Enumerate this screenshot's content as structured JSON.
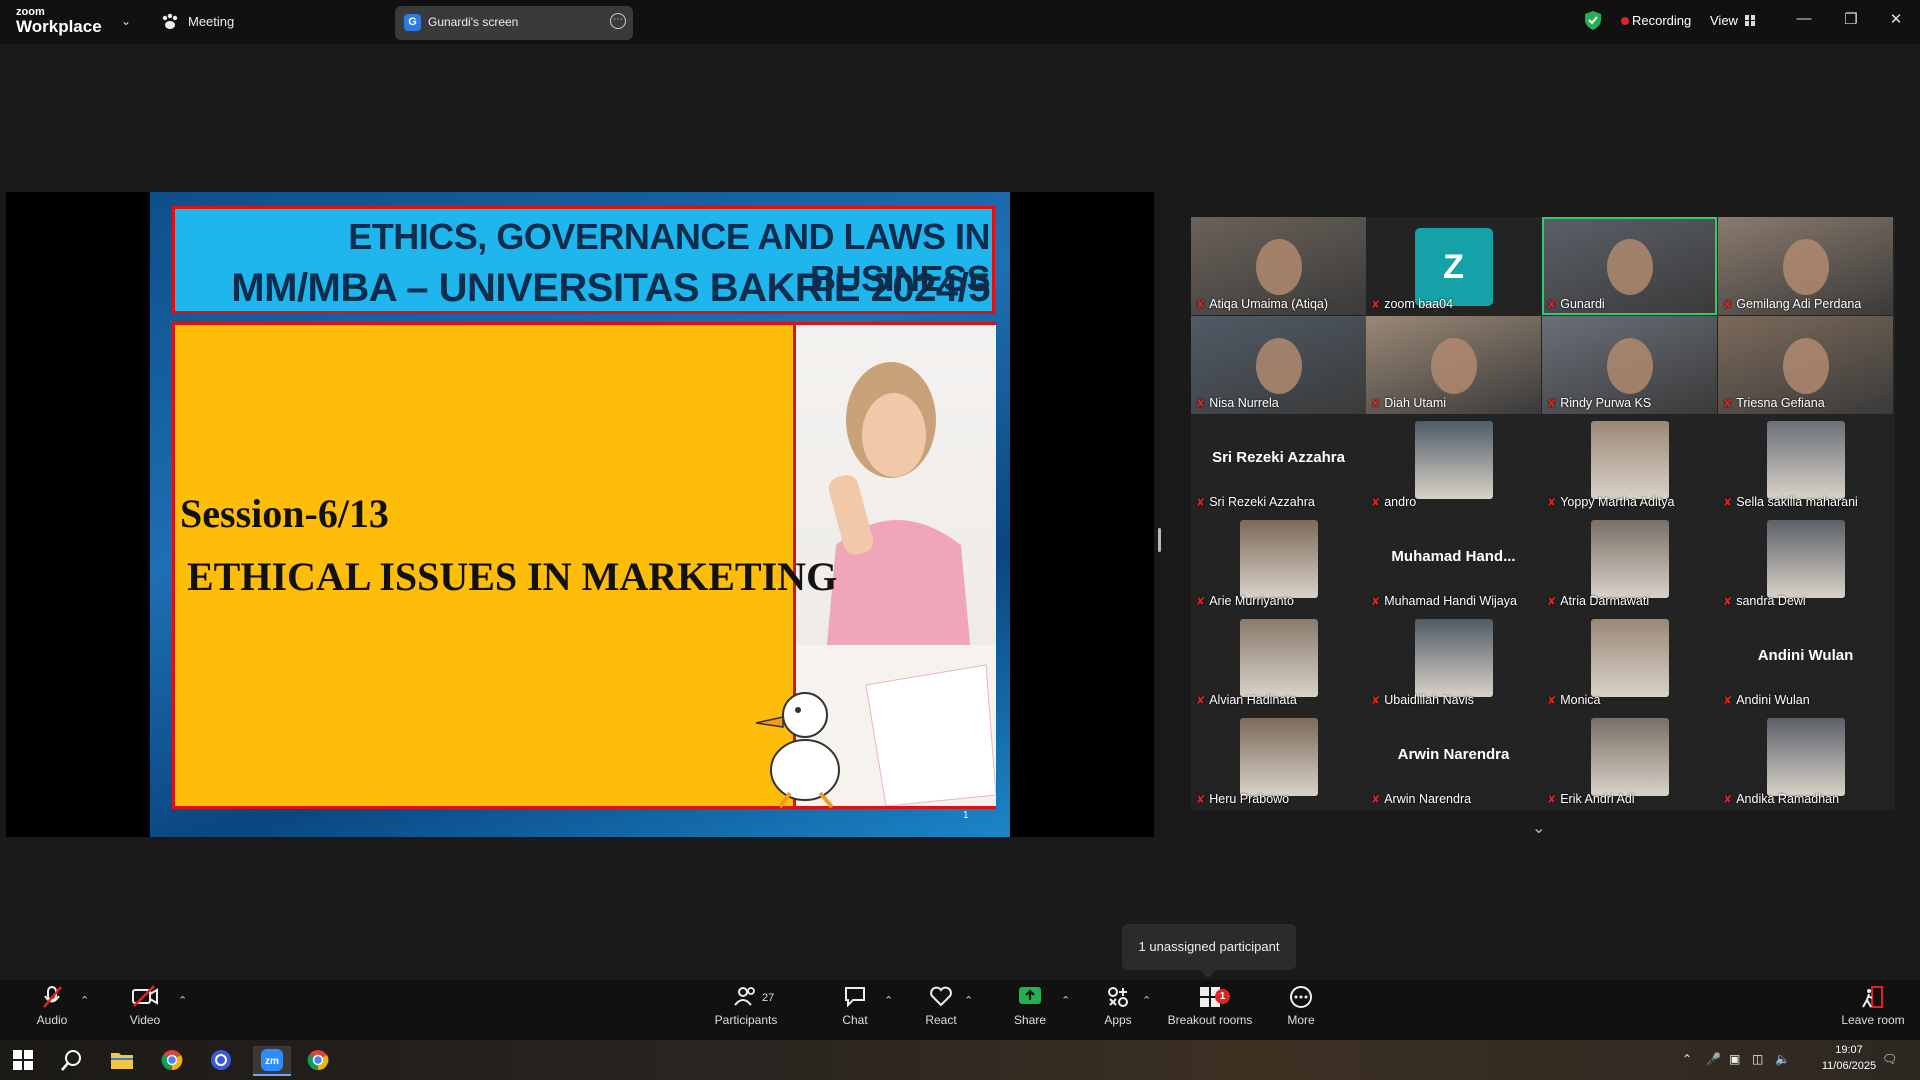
{
  "window": {
    "logo_small": "zoom",
    "logo_big": "Workplace",
    "meeting_label": "Meeting",
    "screen_tab_initial": "G",
    "screen_tab_label": "Gunardi's screen",
    "recording_label": "Recording",
    "view_label": "View",
    "recording_color": "#e02424"
  },
  "slide": {
    "title_line1": "ETHICS, GOVERNANCE AND LAWS IN BUSINESS",
    "title_line2": "MM/MBA – UNIVERSITAS BAKRIE 2024/5",
    "session": "Session-6/13",
    "topic": "ETHICAL ISSUES IN MARKETING",
    "page_number": "1",
    "header_color": "#1fb6ee",
    "body_color": "#fdbd09"
  },
  "gallery": {
    "tiles": [
      {
        "name": "Atiqa Umaima (Atiqa)",
        "kind": "video"
      },
      {
        "name": "zoom baa04",
        "kind": "avatar",
        "avatar_letter": "Z"
      },
      {
        "name": "Gunardi",
        "kind": "video",
        "active": true
      },
      {
        "name": "Gemilang Adi Perdana",
        "kind": "video"
      },
      {
        "name": "Nisa Nurrela",
        "kind": "video"
      },
      {
        "name": "Diah Utami",
        "kind": "video"
      },
      {
        "name": "Rindy Purwa KS",
        "kind": "video"
      },
      {
        "name": "Triesna Gefiana",
        "kind": "video"
      },
      {
        "name": "Sri Rezeki Azzahra",
        "kind": "text",
        "center_text": "Sri Rezeki Azzahra"
      },
      {
        "name": "andro",
        "kind": "photo"
      },
      {
        "name": "Yoppy Martha Aditya",
        "kind": "photo"
      },
      {
        "name": "Sella sakilla maharani",
        "kind": "photo"
      },
      {
        "name": "Arie Murriyanto",
        "kind": "photo"
      },
      {
        "name": "Muhamad Handi Wijaya",
        "kind": "text",
        "center_text": "Muhamad  Hand..."
      },
      {
        "name": "Atria Darmawati",
        "kind": "photo"
      },
      {
        "name": "sandra Dewi",
        "kind": "photo"
      },
      {
        "name": "Alvian Hadinata",
        "kind": "photo"
      },
      {
        "name": "Ubaidillah Navis",
        "kind": "photo"
      },
      {
        "name": "Monica",
        "kind": "photo"
      },
      {
        "name": "Andini Wulan",
        "kind": "text",
        "center_text": "Andini Wulan"
      },
      {
        "name": "Heru Prabowo",
        "kind": "photo"
      },
      {
        "name": "Arwin Narendra",
        "kind": "text",
        "center_text": "Arwin Narendra"
      },
      {
        "name": "Erik Andri Adi",
        "kind": "photo"
      },
      {
        "name": "Andika Ramadhan",
        "kind": "photo"
      }
    ]
  },
  "tooltip": "1 unassigned participant",
  "toolbar": {
    "audio": "Audio",
    "video": "Video",
    "participants": "Participants",
    "participant_count": "27",
    "chat": "Chat",
    "react": "React",
    "share": "Share",
    "apps": "Apps",
    "breakout": "Breakout rooms",
    "breakout_badge": "1",
    "more": "More",
    "leave": "Leave room"
  },
  "taskbar": {
    "time": "19:07",
    "date": "11/06/2025"
  }
}
